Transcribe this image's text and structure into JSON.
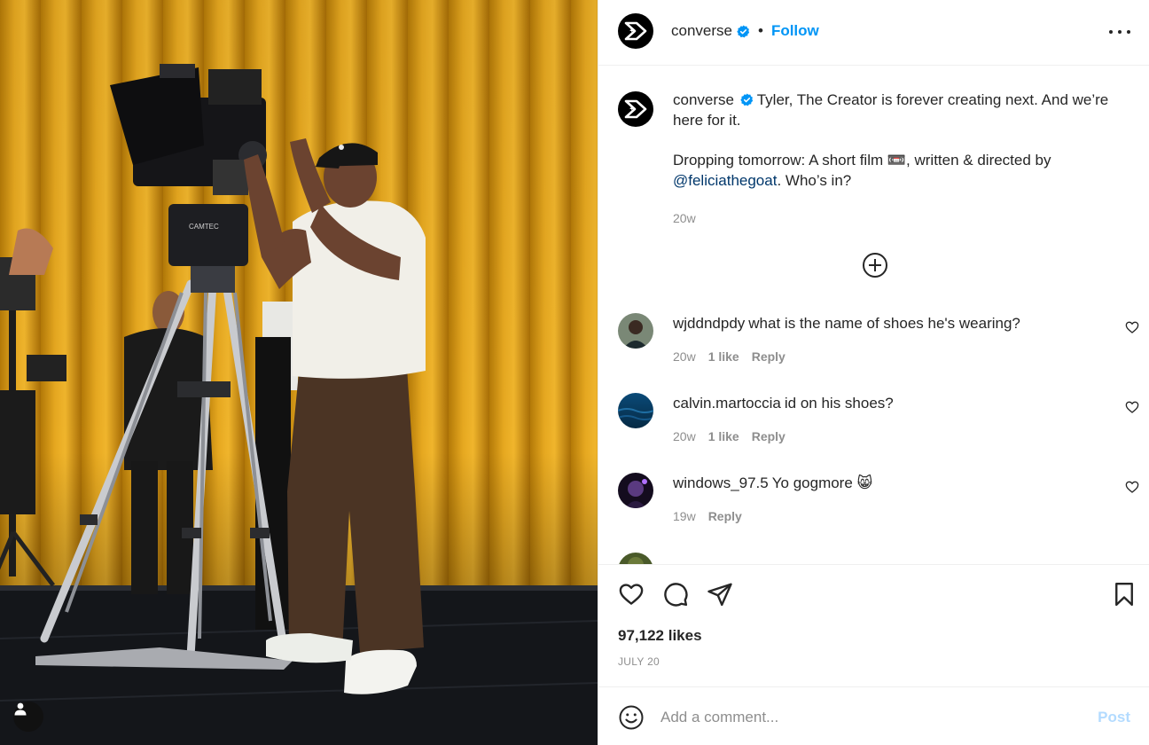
{
  "post": {
    "username": "converse",
    "follow_label": "Follow",
    "separator": "•"
  },
  "caption": {
    "username": "converse",
    "line1": "Tyler, The Creator is forever creating next. And we’re here for it.",
    "line2_prefix": "Dropping tomorrow: A short film 📼, written & directed by",
    "mention": "@feliciathegoat",
    "line2_suffix": ". Who’s in?",
    "time": "20w"
  },
  "comments": [
    {
      "username": "wjddndpdy",
      "text": "what is the name of shoes he's wearing?",
      "time": "20w",
      "likes": "1 like",
      "reply": "Reply"
    },
    {
      "username": "calvin.martoccia",
      "text": "id on his shoes?",
      "time": "20w",
      "likes": "1 like",
      "reply": "Reply"
    },
    {
      "username": "windows_97.5",
      "text": "Yo gogmore 😸",
      "time": "19w",
      "reply": "Reply"
    }
  ],
  "actions": {
    "likes_count": "97,122 likes",
    "date": "JULY 20"
  },
  "composer": {
    "placeholder": "Add a comment...",
    "post_label": "Post"
  },
  "icons": {
    "brand_logo": "converse-logo-icon",
    "verified": "verified-badge-icon",
    "more": "more-options-icon",
    "load_more": "plus-circle-icon",
    "like": "heart-icon",
    "comment": "comment-icon",
    "share": "share-icon",
    "save": "bookmark-icon",
    "emoji": "emoji-icon",
    "tag": "user-tag-icon"
  },
  "colors": {
    "accent": "#0095f6",
    "post_disabled": "#b3dbff",
    "curtain": "#d4960f",
    "mention": "#00376b"
  }
}
